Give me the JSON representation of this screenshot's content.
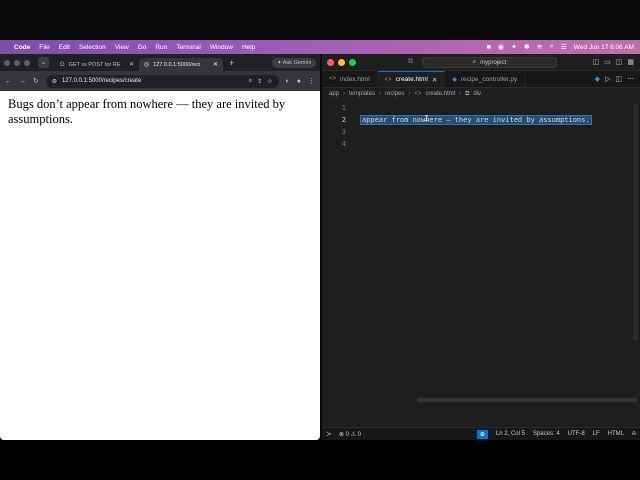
{
  "menubar": {
    "app": "Code",
    "items": [
      "File",
      "Edit",
      "Selection",
      "View",
      "Go",
      "Run",
      "Terminal",
      "Window",
      "Help"
    ],
    "datetime": "Wed Jun 17  6:06 AM"
  },
  "browser": {
    "tabs": [
      {
        "label": "GET vs POST for RE"
      },
      {
        "label": "127.0.0.1:5000/reci"
      }
    ],
    "gemini_label": "Ask Gemini",
    "url": "127.0.0.1:5000/recipes/create",
    "page_text": "Bugs don’t appear from nowhere — they are invited by assumptions."
  },
  "vscode": {
    "search_label": "myproject",
    "tabs": [
      {
        "label": "index.html",
        "icon": "html-icon"
      },
      {
        "label": "create.html",
        "icon": "html-icon"
      },
      {
        "label": "recipe_controller.py",
        "icon": "python-icon"
      }
    ],
    "breadcrumb": [
      "app",
      "templates",
      "recipes",
      "create.html",
      "div"
    ],
    "line_numbers": [
      "1",
      "2",
      "3",
      "4"
    ],
    "selected_code": "appear from nowhere — they are invited by assumptions.",
    "status": {
      "problems": "0",
      "warnings": "0",
      "position": "Ln 2, Col 5",
      "spaces": "Spaces: 4",
      "encoding": "UTF-8",
      "eol": "LF",
      "language": "HTML"
    }
  },
  "colors": {
    "selection": "#264f78",
    "accent": "#0078d4"
  }
}
